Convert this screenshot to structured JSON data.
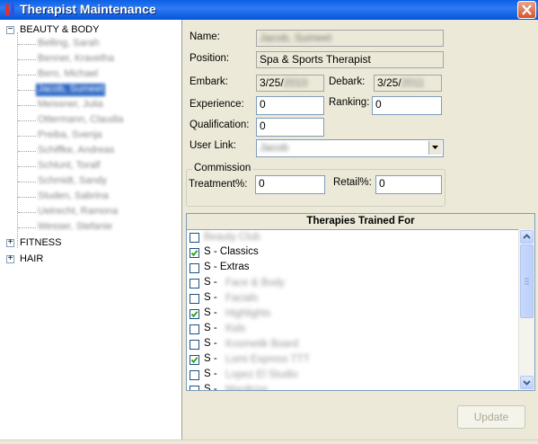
{
  "window": {
    "title": "Therapist Maintenance"
  },
  "tree": {
    "groups": [
      {
        "label": "BEAUTY & BODY",
        "expander": "−"
      },
      {
        "label": "FITNESS",
        "expander": "+"
      },
      {
        "label": "HAIR",
        "expander": "+"
      }
    ]
  },
  "form": {
    "name_label": "Name:",
    "position_label": "Position:",
    "position_value": "Spa & Sports Therapist",
    "embark_label": "Embark:",
    "embark_value": "3/25/",
    "debark_label": "Debark:",
    "debark_value": "3/25/",
    "experience_label": "Experience:",
    "experience_value": "0",
    "ranking_label": "Ranking:",
    "ranking_value": "0",
    "qualification_label": "Qualification:",
    "qualification_value": "0",
    "userlink_label": "User Link:",
    "commission_title": "Commission",
    "treatment_label": "Treatment%:",
    "treatment_value": "0",
    "retail_label": "Retail%:",
    "retail_value": "0"
  },
  "therapies": {
    "header": "Therapies Trained For",
    "rows": [
      {
        "text": "",
        "checked": false
      },
      {
        "text": "S - Classics",
        "checked": true
      },
      {
        "text": "S - Extras",
        "checked": false
      },
      {
        "text": "S -",
        "checked": false
      },
      {
        "text": "S -",
        "checked": false
      },
      {
        "text": "S -",
        "checked": true
      },
      {
        "text": "S -",
        "checked": false
      },
      {
        "text": "S -",
        "checked": false
      },
      {
        "text": "S -",
        "checked": true
      },
      {
        "text": "S -",
        "checked": false
      },
      {
        "text": "S -",
        "checked": false
      }
    ]
  },
  "actions": {
    "update_label": "Update"
  }
}
